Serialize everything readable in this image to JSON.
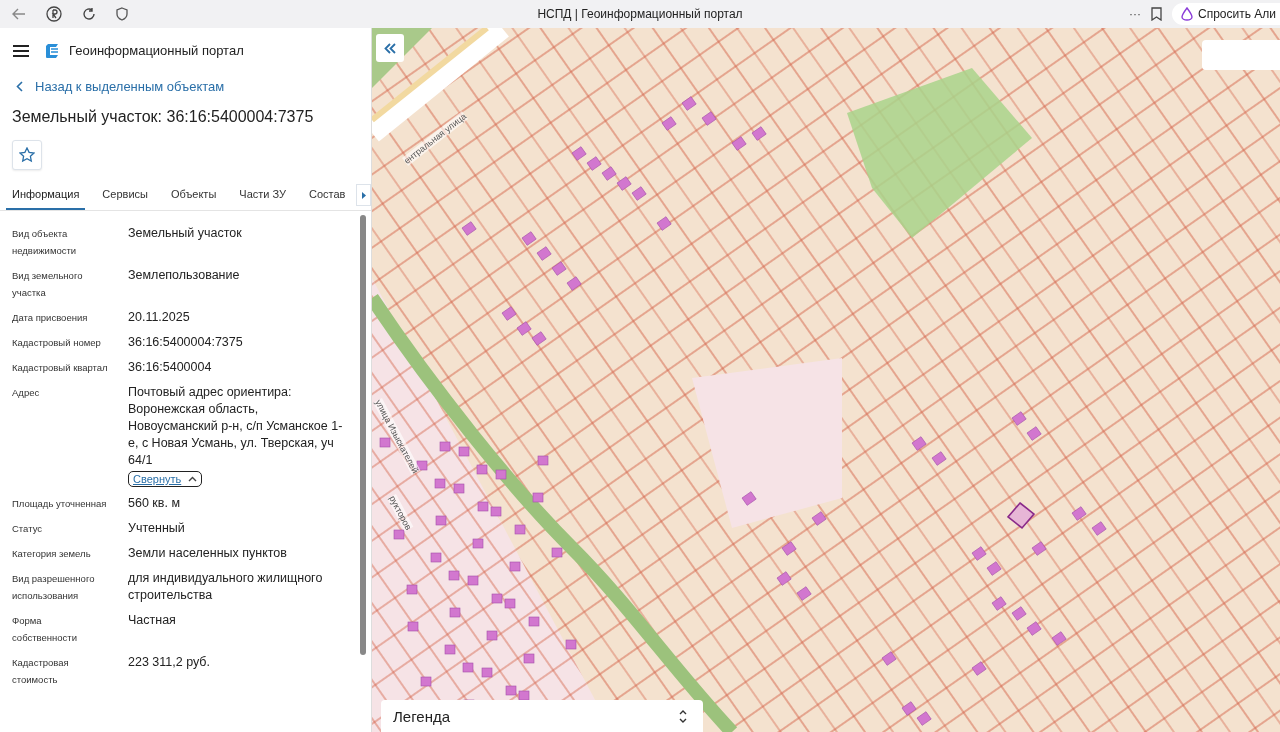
{
  "browser": {
    "title": "НСПД | Геоинформационный портал",
    "more": "···",
    "assistant": "Спросить Али"
  },
  "app": {
    "title": "Геоинформационный портал"
  },
  "back_link": "Назад к выделенным объектам",
  "object_title": "Земельный участок: 36:16:5400004:7375",
  "favorite": {
    "selected": false
  },
  "tabs": [
    {
      "label": "Информация",
      "selected": true
    },
    {
      "label": "Сервисы",
      "selected": false
    },
    {
      "label": "Объекты",
      "selected": false
    },
    {
      "label": "Части ЗУ",
      "selected": false
    },
    {
      "label": "Состав",
      "selected": false
    }
  ],
  "fields": [
    {
      "label": "Вид объекта недвижимости",
      "value": "Земельный участок"
    },
    {
      "label": "Вид земельного участка",
      "value": "Землепользование"
    },
    {
      "label": "Дата присвоения",
      "value": "20.11.2025"
    },
    {
      "label": "Кадастровый номер",
      "value": "36:16:5400004:7375"
    },
    {
      "label": "Кадастровый квартал",
      "value": "36:16:5400004"
    },
    {
      "label": "Адрес",
      "value": "Почтовый адрес ориентира: Воронежская область, Новоусманский р-н, с/п Усманское 1-е, с Новая Усмань, ул. Тверская, уч 64/1",
      "toggle": "Свернуть",
      "expanded": true
    },
    {
      "label": "Площадь уточненная",
      "value": "560 кв. м"
    },
    {
      "label": "Статус",
      "value": "Учтенный"
    },
    {
      "label": "Категория земель",
      "value": "Земли населенных пунктов"
    },
    {
      "label": "Вид разрешенного использования",
      "value": "для индивидуального жилищного строительства"
    },
    {
      "label": "Форма собственности",
      "value": "Частная"
    },
    {
      "label": "Кадастровая стоимость",
      "value": "223 311,2 руб."
    }
  ],
  "map": {
    "street_labels": [
      "ентральная улица",
      "улица Изыскателей",
      "рукторов"
    ],
    "legend": {
      "title": "Легенда",
      "expanded": false
    }
  }
}
